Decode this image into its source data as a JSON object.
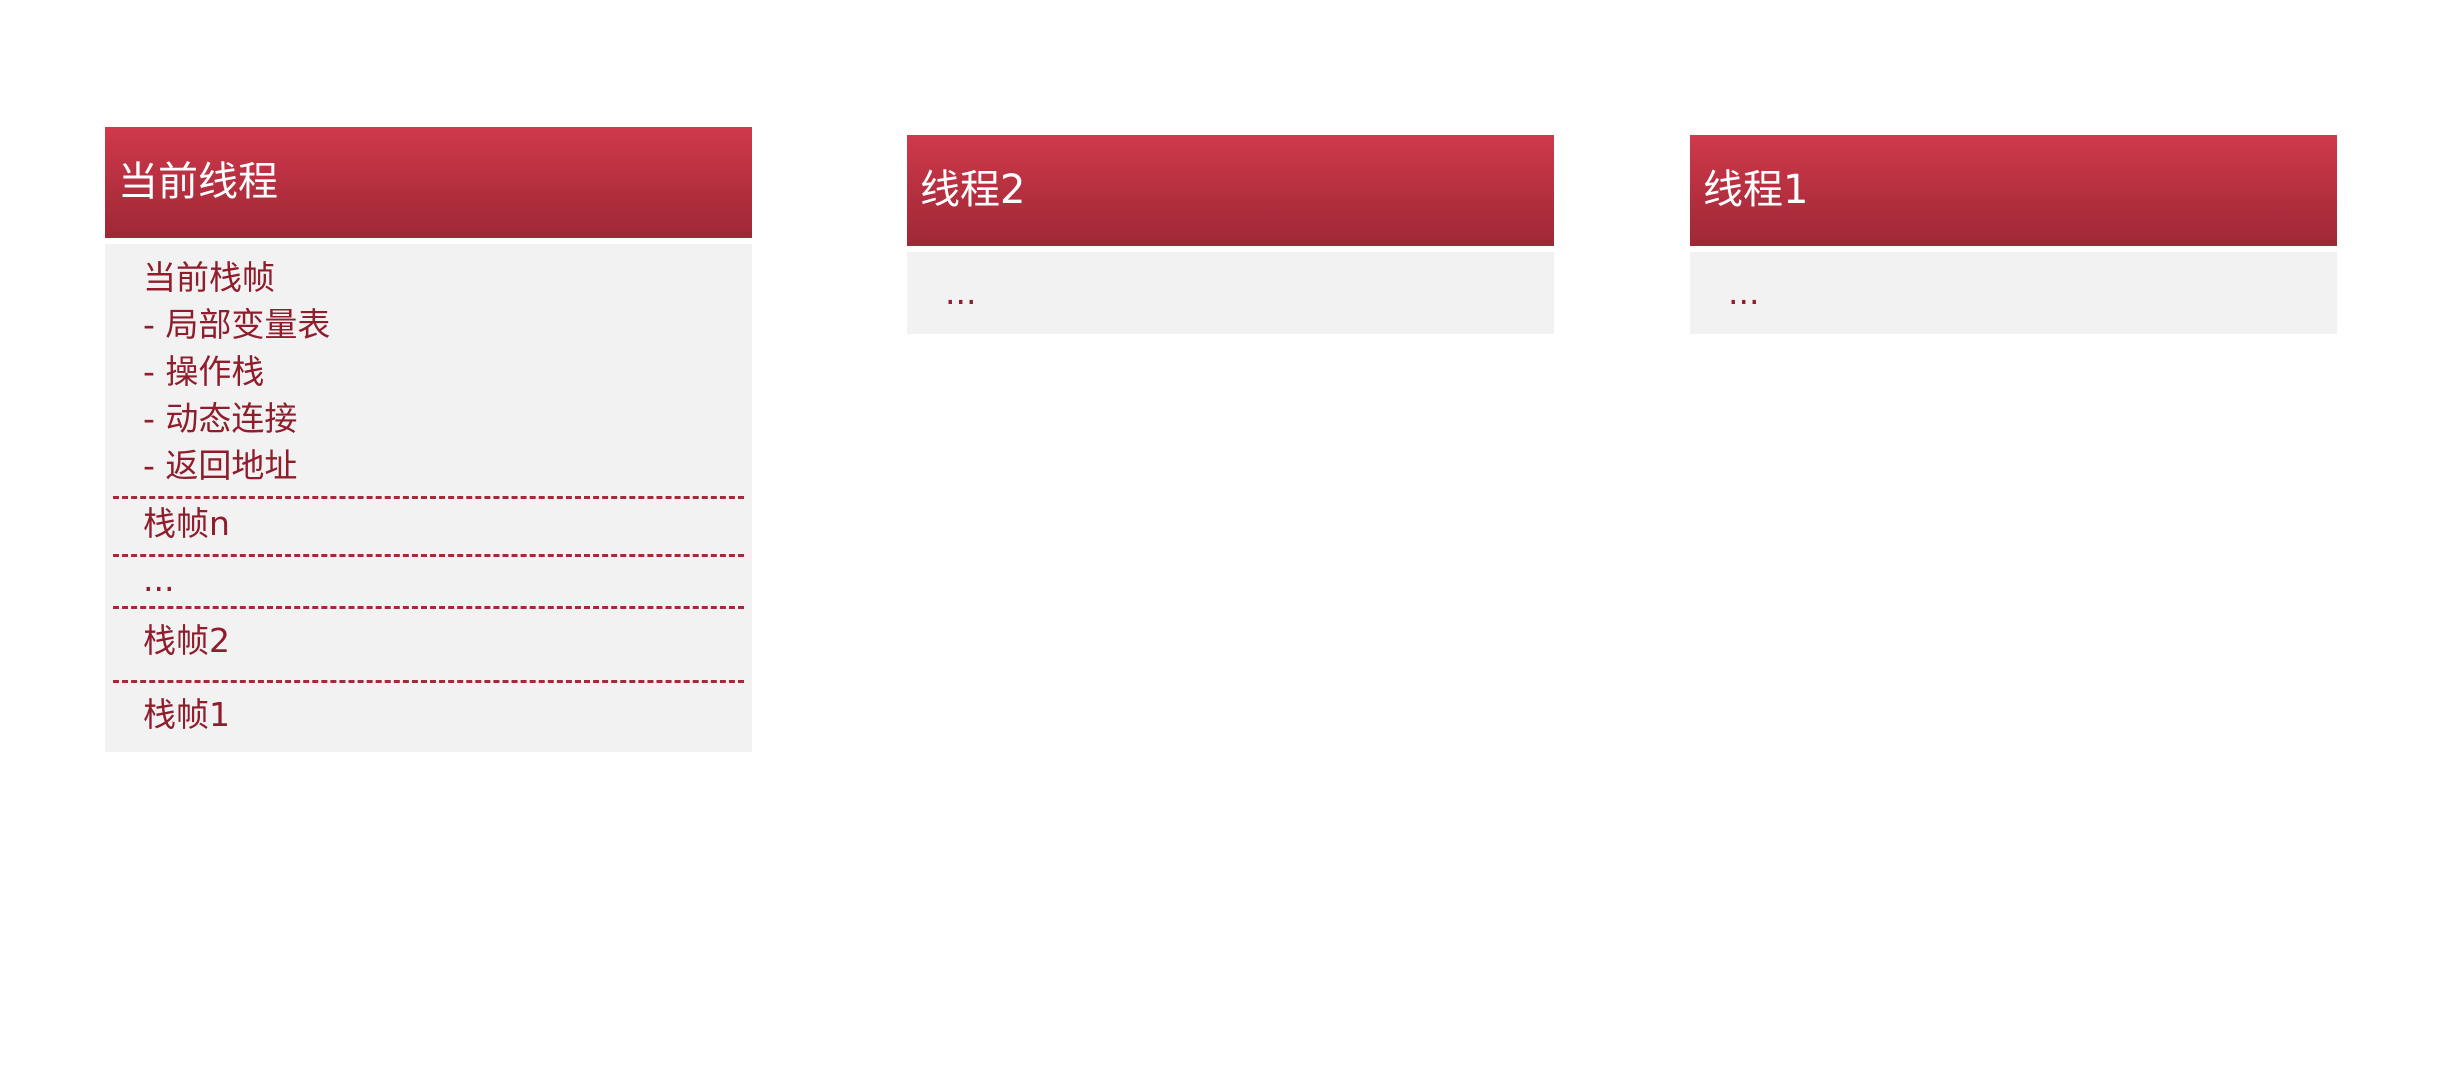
{
  "current_thread": {
    "title": "当前线程",
    "current_frame": {
      "label": "当前栈帧",
      "items": [
        "- 局部变量表",
        "- 操作栈",
        "- 动态连接",
        "- 返回地址"
      ]
    },
    "frames": [
      "栈帧n",
      "...",
      "栈帧2",
      "栈帧1"
    ]
  },
  "thread2": {
    "title": "线程2",
    "body": "..."
  },
  "thread1": {
    "title": "线程1",
    "body": "..."
  },
  "colors": {
    "header_red": "#b42f3f",
    "text_red": "#8f1d2c",
    "body_gray": "#f2f2f2"
  }
}
